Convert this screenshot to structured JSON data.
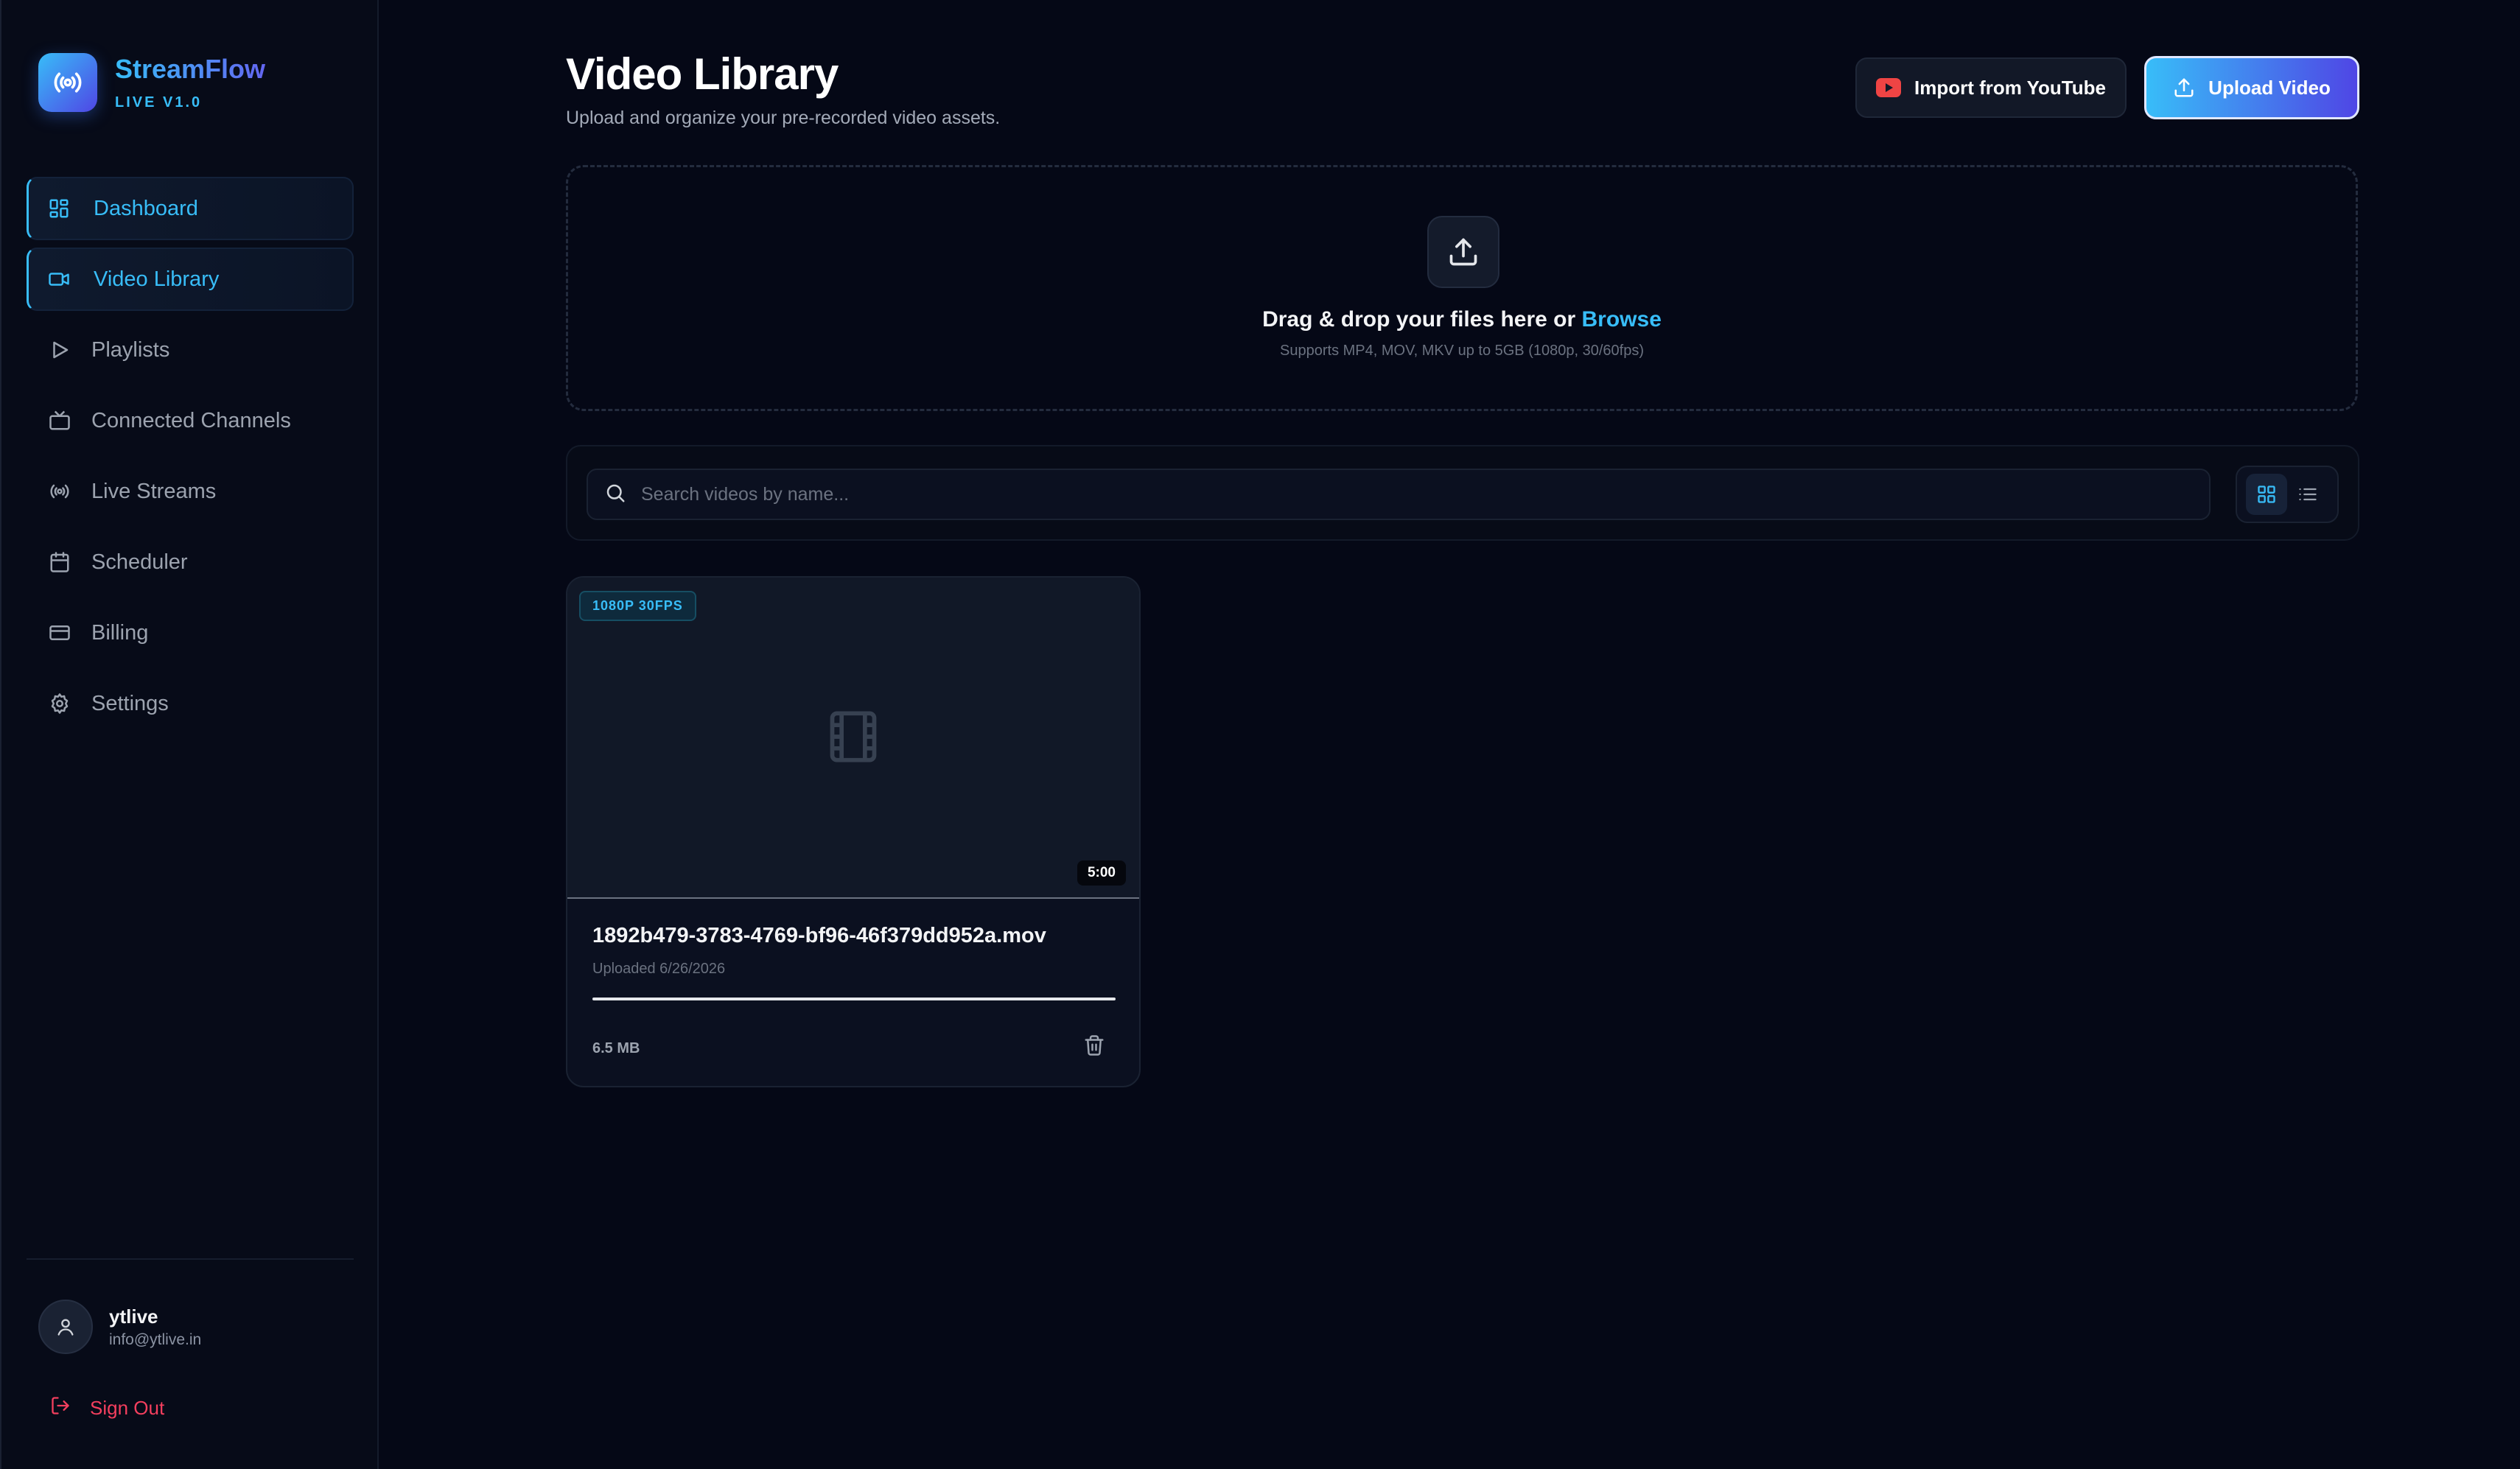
{
  "brand": {
    "name": "StreamFlow",
    "version": "LIVE V1.0"
  },
  "sidebar": {
    "items": [
      {
        "label": "Dashboard",
        "icon": "dashboard-grid-icon",
        "active": true
      },
      {
        "label": "Video Library",
        "icon": "video-camera-icon",
        "active": true
      },
      {
        "label": "Playlists",
        "icon": "play-icon",
        "active": false
      },
      {
        "label": "Connected Channels",
        "icon": "tv-icon",
        "active": false
      },
      {
        "label": "Live Streams",
        "icon": "broadcast-icon",
        "active": false
      },
      {
        "label": "Scheduler",
        "icon": "calendar-icon",
        "active": false
      },
      {
        "label": "Billing",
        "icon": "credit-card-icon",
        "active": false
      },
      {
        "label": "Settings",
        "icon": "gear-icon",
        "active": false
      }
    ],
    "user": {
      "name": "ytlive",
      "email": "info@ytlive.in"
    },
    "sign_out_label": "Sign Out"
  },
  "header": {
    "title": "Video Library",
    "subtitle": "Upload and organize your pre-recorded video assets.",
    "import_label": "Import from YouTube",
    "upload_label": "Upload Video"
  },
  "dropzone": {
    "title_prefix": "Drag & drop your files here or ",
    "browse_label": "Browse",
    "subtitle": "Supports MP4, MOV, MKV up to 5GB (1080p, 30/60fps)"
  },
  "search": {
    "placeholder": "Search videos by name...",
    "value": ""
  },
  "view_mode": "grid",
  "videos": [
    {
      "badge": "1080P 30FPS",
      "duration": "5:00",
      "name": "1892b479-3783-4769-bf96-46f379dd952a.mov",
      "uploaded": "Uploaded 6/26/2026",
      "size": "6.5 MB",
      "progress_fraction": 1.0
    }
  ],
  "colors": {
    "accent": "#38bdf8",
    "accent_secondary": "#4f46e5",
    "background": "#050816",
    "danger": "#f43f5e",
    "youtube": "#ef4444"
  }
}
